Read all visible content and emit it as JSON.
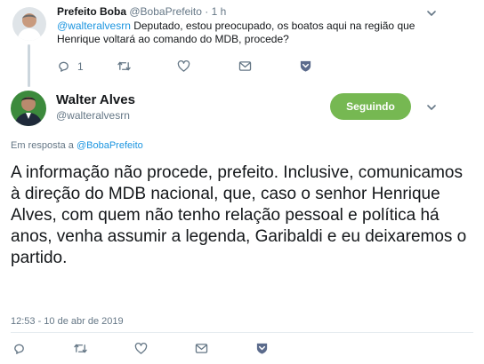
{
  "reply": {
    "name": "Prefeito Boba",
    "handle": "@BobaPrefeito",
    "separator": "·",
    "time": "1 h",
    "mention": "@walteralvesrn",
    "text": "Deputado, estou preocupado, os boatos aqui na região que Henrique voltará ao comando do MDB, procede?",
    "reply_count": "1"
  },
  "tweet": {
    "name": "Walter Alves",
    "handle": "@walteralvesrn",
    "follow_label": "Seguindo",
    "reply_to_prefix": "Em resposta a",
    "reply_to_handle": "@BobaPrefeito",
    "text": "A informação não procede, prefeito. Inclusive, comunicamos à direção do MDB nacional, que, caso o senhor Henrique Alves, com quem não tenho relação pessoal e política há anos, venha assumir a legenda, Garibaldi e eu deixaremos o partido.",
    "timestamp": "12:53 - 10 de abr de 2019"
  },
  "colors": {
    "follow_button": "#76b852",
    "link": "#1b95e0",
    "muted": "#657786",
    "dm_icon": "#5b6b8c"
  },
  "icons": [
    "reply-icon",
    "retweet-icon",
    "like-icon",
    "message-icon",
    "dm-shield-icon",
    "chevron-down-icon"
  ]
}
